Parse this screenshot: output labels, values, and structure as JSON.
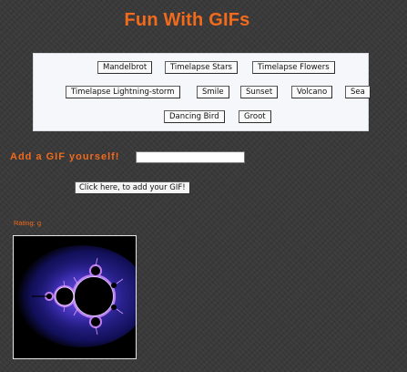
{
  "page": {
    "title": "Fun With GIFs"
  },
  "gif_buttons": [
    {
      "label": "Mandelbrot"
    },
    {
      "label": "Timelapse Stars"
    },
    {
      "label": "Timelapse Flowers"
    },
    {
      "label": "Timelapse Lightning-storm"
    },
    {
      "label": "Smile"
    },
    {
      "label": "Sunset"
    },
    {
      "label": "Volcano"
    },
    {
      "label": "Sea"
    },
    {
      "label": "Dancing Bird"
    },
    {
      "label": "Groot"
    }
  ],
  "add_gif": {
    "label": "Add a GIF yourself!",
    "input_value": "",
    "button_label": "Click here, to add your GIF!"
  },
  "gif_display": {
    "rating_text": "Rating: g",
    "current_gif": "Mandelbrot"
  },
  "colors": {
    "accent": "#f26a1c",
    "background": "#3a3a3a",
    "panel": "#f6f7fb"
  }
}
